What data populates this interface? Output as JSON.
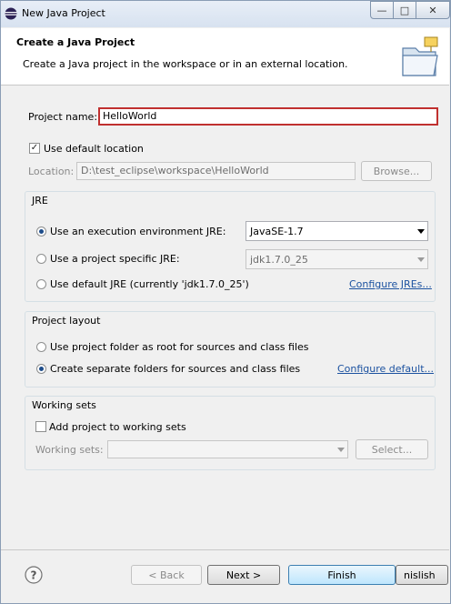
{
  "window": {
    "title": "New Java Project",
    "minimize": "—",
    "maximize": "□",
    "close": "✕"
  },
  "banner": {
    "title": "Create a Java Project",
    "description": "Create a Java project in the workspace or in an external location.",
    "icon": "new-java-project-wizard-icon"
  },
  "project_name": {
    "label": "Project name:",
    "value": "HelloWorld"
  },
  "location": {
    "use_default_label": "Use default location",
    "use_default_checked": true,
    "label": "Location:",
    "value": "D:\\test_eclipse\\workspace\\HelloWorld",
    "browse_label": "Browse..."
  },
  "jre": {
    "group_label": "JRE",
    "options": [
      {
        "label": "Use an execution environment JRE:",
        "selected": true
      },
      {
        "label": "Use a project specific JRE:",
        "selected": false
      },
      {
        "label": "Use default JRE (currently 'jdk1.7.0_25')",
        "selected": false
      }
    ],
    "env_value": "JavaSE-1.7",
    "specific_value": "jdk1.7.0_25",
    "configure_link": "Configure JREs..."
  },
  "layout": {
    "group_label": "Project layout",
    "options": [
      {
        "label": "Use project folder as root for sources and class files",
        "selected": false
      },
      {
        "label": "Create separate folders for sources and class files",
        "selected": true
      }
    ],
    "configure_link": "Configure default..."
  },
  "working_sets": {
    "group_label": "Working sets",
    "add_label": "Add project to working sets",
    "add_checked": false,
    "sets_label": "Working sets:",
    "sets_value": "",
    "select_label": "Select..."
  },
  "footer": {
    "help_icon": "help-icon",
    "back_label": "< Back",
    "next_label": "Next >",
    "finish_label": "Finish",
    "cancel_partial": "nislish"
  },
  "colors": {
    "focus_border": "#c0302f",
    "link": "#1c52a0",
    "radio_dot": "#1d4c8a"
  }
}
